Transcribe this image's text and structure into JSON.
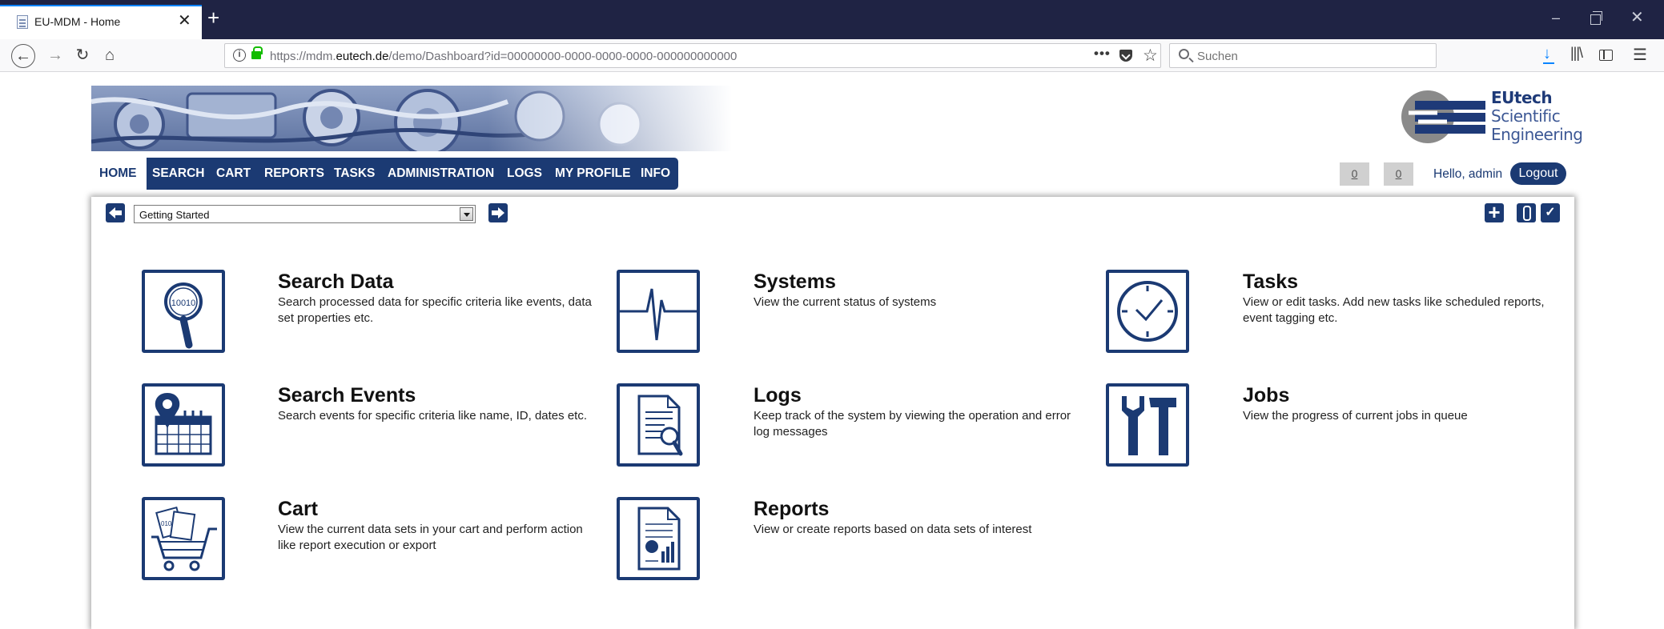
{
  "browser": {
    "tab_title": "EU-MDM - Home",
    "url": "https://mdm.eutech.de/demo/Dashboard?id=00000000-0000-0000-0000-000000000000",
    "url_host_prefix": "https://mdm.",
    "url_host_domain": "eutech.de",
    "url_path": "/demo/Dashboard?id=00000000-0000-0000-0000-000000000000",
    "search_placeholder": "Suchen"
  },
  "header": {
    "logo": {
      "line1": "EUtech",
      "line2": "Scientific",
      "line3": "Engineering"
    },
    "nav": [
      "HOME",
      "SEARCH",
      "CART",
      "REPORTS",
      "TASKS",
      "ADMINISTRATION",
      "LOGS",
      "MY PROFILE",
      "INFO"
    ],
    "active_nav": "HOME",
    "counter_1": "0",
    "counter_2": "0",
    "greeting": "Hello, admin",
    "logout_label": "Logout"
  },
  "dashboard": {
    "selected_view": "Getting Started",
    "tiles": [
      {
        "title": "Search Data",
        "desc": "Search processed data for specific criteria like events, data set properties etc.",
        "icon": "search-data-icon"
      },
      {
        "title": "Systems",
        "desc": "View the current status of systems",
        "icon": "systems-pulse-icon"
      },
      {
        "title": "Tasks",
        "desc": "View or edit tasks. Add new tasks like scheduled reports, event tagging etc.",
        "icon": "clock-icon"
      },
      {
        "title": "Search Events",
        "desc": "Search events for specific criteria like name, ID, dates etc.",
        "icon": "calendar-pin-icon"
      },
      {
        "title": "Logs",
        "desc": "Keep track of the system by viewing the operation and error log messages",
        "icon": "log-document-icon"
      },
      {
        "title": "Jobs",
        "desc": "View the progress of current jobs in queue",
        "icon": "tools-icon"
      },
      {
        "title": "Cart",
        "desc": "View the current data sets in your cart and perform action like report execution or export",
        "icon": "cart-icon"
      },
      {
        "title": "Reports",
        "desc": "View or create reports based on data sets of interest",
        "icon": "report-chart-icon"
      }
    ]
  },
  "colors": {
    "brand": "#1b3a73",
    "tab_bar": "#1f2344",
    "lock": "#12bc00"
  }
}
